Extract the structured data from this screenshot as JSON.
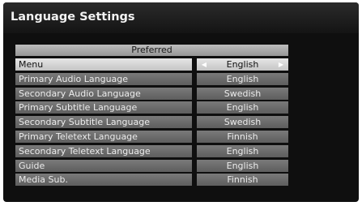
{
  "window": {
    "title": "Language Settings"
  },
  "table": {
    "header": "Preferred",
    "rows": [
      {
        "label": "Menu",
        "value": "English",
        "selected": true
      },
      {
        "label": "Primary Audio Language",
        "value": "English"
      },
      {
        "label": "Secondary Audio Language",
        "value": "Swedish"
      },
      {
        "label": "Primary Subtitle Language",
        "value": "English"
      },
      {
        "label": "Secondary Subtitle Language",
        "value": "Swedish"
      },
      {
        "label": "Primary Teletext Language",
        "value": "Finnish"
      },
      {
        "label": "Secondary Teletext Language",
        "value": "English"
      },
      {
        "label": "Guide",
        "value": "English"
      },
      {
        "label": "Media Sub.",
        "value": "Finnish"
      }
    ]
  },
  "icons": {
    "left_arrow": "arrow-left-icon",
    "right_arrow": "arrow-right-icon"
  },
  "colors": {
    "background": "#0f0f0f",
    "row": "#6b6b6b",
    "selected_row": "#d9d9d9",
    "header": "#a8a8a8"
  }
}
